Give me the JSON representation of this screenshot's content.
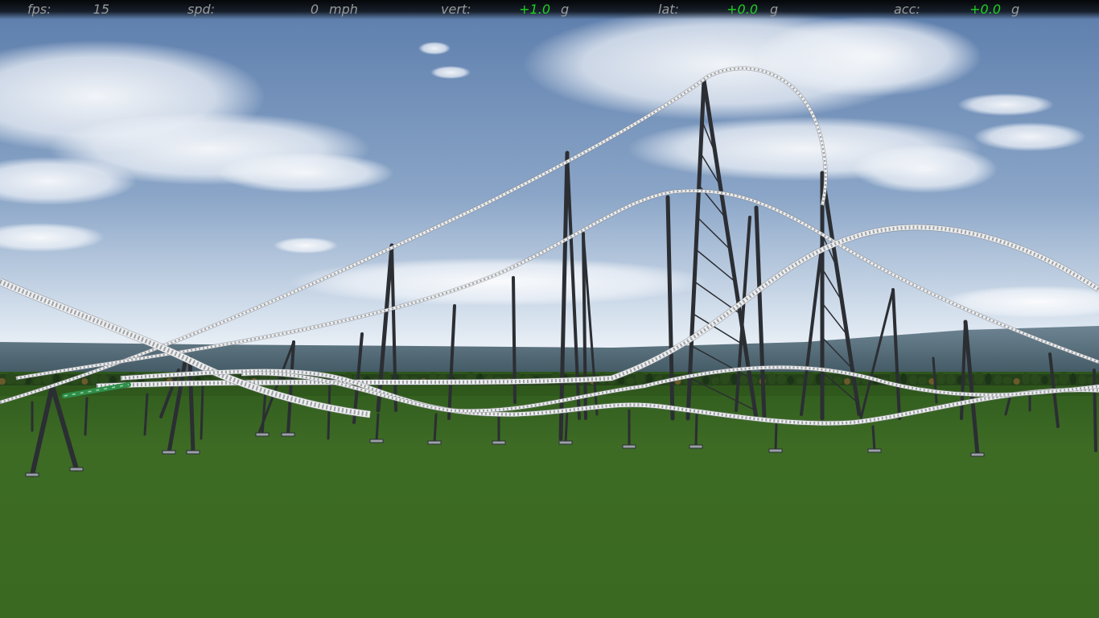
{
  "hud": {
    "fps_label": "fps:",
    "fps_value": "15",
    "spd_label": "spd:",
    "spd_value": "0",
    "spd_unit": "mph",
    "vert_label": "vert:",
    "vert_value": "+1.0",
    "vert_unit": "g",
    "lat_label": "lat:",
    "lat_value": "+0.0",
    "lat_unit": "g",
    "acc_label": "acc:",
    "acc_value": "+0.0",
    "acc_unit": "g"
  },
  "colors": {
    "hud_label": "#9a9a9a",
    "hud_value_positive": "#1fd21f",
    "sky_top": "#5f7fae",
    "sky_horizon": "#dfe8f2",
    "grass": "#3c6a22",
    "track": "#e8e8e8",
    "support": "#2b2e33",
    "train": "#2f8f4a"
  },
  "scene": {
    "description_icon": "roller-coaster-3d-view"
  }
}
